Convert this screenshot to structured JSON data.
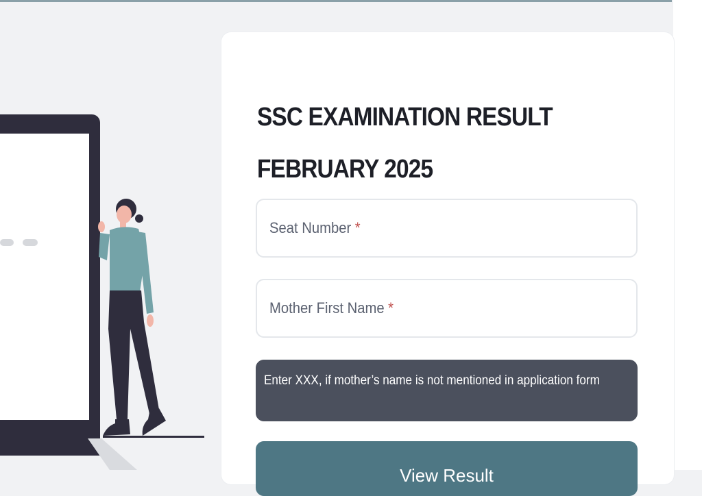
{
  "form": {
    "title_line1": "SSC EXAMINATION RESULT",
    "title_line2": "FEBRUARY 2025",
    "seat_label": "Seat Number",
    "mother_label": "Mother First Name",
    "required_mark": "*",
    "note": "Enter XXX, if mother’s name is not mentioned in application form",
    "view_button": "View Result"
  },
  "colors": {
    "background": "#f1f2f4",
    "card": "#ffffff",
    "note_bg": "#4b505d",
    "button_bg": "#4e7784",
    "required": "#c0504d"
  }
}
